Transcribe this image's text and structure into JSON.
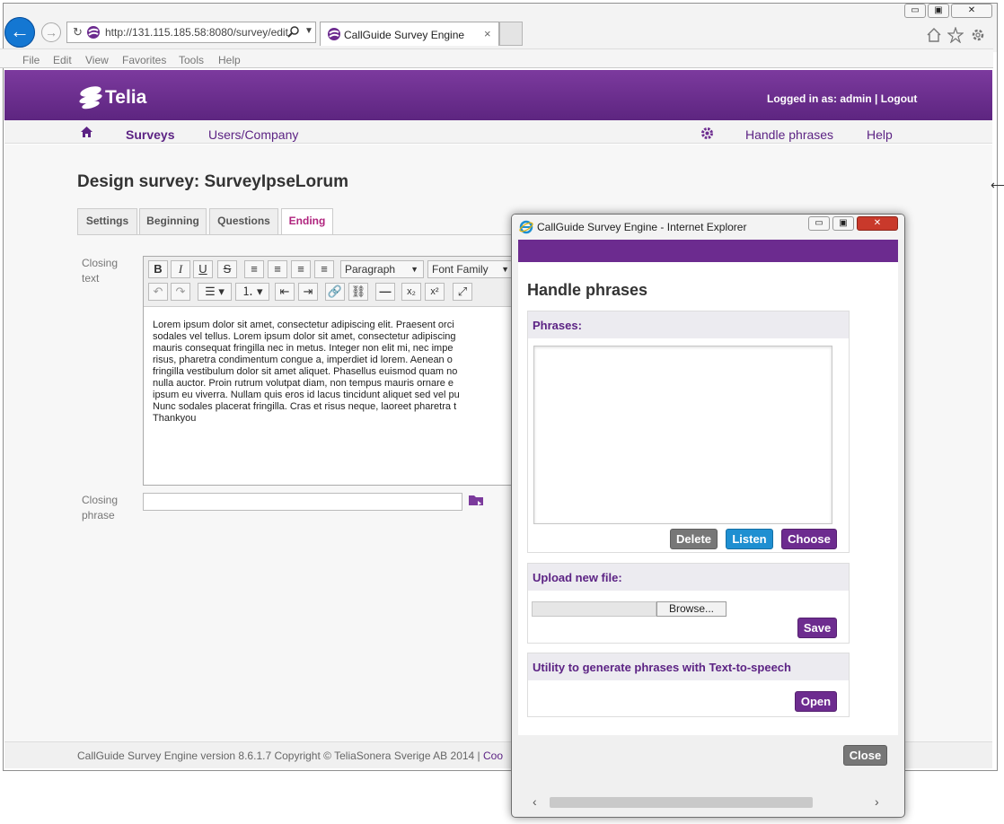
{
  "browser": {
    "address": "http://131.115.185.58:8080/survey/edit",
    "tab_title": "CallGuide Survey Engine",
    "tab_close": "×",
    "back_arrow": "←",
    "forward_arrow": "→",
    "window_buttons": [
      "▭",
      "▣",
      "✕"
    ],
    "menu": [
      "File",
      "Edit",
      "View",
      "Favorites",
      "Tools",
      "Help"
    ],
    "icons": [
      "home-icon",
      "star-icon",
      "gear-icon"
    ]
  },
  "header": {
    "logo": "Telia",
    "logged_in_prefix": "Logged in as: ",
    "user": "admin",
    "separator": " | ",
    "logout": "Logout"
  },
  "nav": {
    "surveys": "Surveys",
    "users": "Users/Company",
    "handle_phrases": "Handle phrases",
    "help": "Help"
  },
  "page": {
    "title": "Design survey: SurveyIpseLorum",
    "tabs": [
      "Settings",
      "Beginning",
      "Questions",
      "Ending"
    ],
    "active_tab": "Ending",
    "closing_text_label_1": "Closing",
    "closing_text_label_2": "text",
    "closing_phrase_label_1": "Closing",
    "closing_phrase_label_2": "phrase",
    "closing_phrase_value": ""
  },
  "editor": {
    "paragraph": "Paragraph",
    "font_family": "Font Family",
    "lines": [
      "Lorem ipsum dolor sit amet, consectetur adipiscing elit. Praesent orci",
      "sodales vel tellus. Lorem ipsum dolor sit amet, consectetur adipiscing",
      "mauris consequat fringilla nec in metus. Integer non elit mi, nec impe",
      "risus, pharetra condimentum congue a, imperdiet id lorem. Aenean o",
      "fringilla vestibulum dolor sit amet aliquet. Phasellus euismod quam no",
      "nulla auctor. Proin rutrum volutpat diam, non tempus mauris ornare e",
      "ipsum eu viverra. Nullam quis eros id lacus tincidunt aliquet sed vel pu",
      "Nunc sodales placerat fringilla. Cras et risus neque, laoreet pharetra t",
      "Thankyou"
    ]
  },
  "footer": {
    "text": "CallGuide Survey Engine version 8.6.1.7 Copyright © TeliaSonera Sverige AB 2014 | ",
    "link": "Coo"
  },
  "popup": {
    "window_title": "CallGuide Survey Engine - Internet Explorer",
    "heading": "Handle phrases",
    "phrases_title": "Phrases:",
    "delete": "Delete",
    "listen": "Listen",
    "choose": "Choose",
    "upload_title": "Upload new file:",
    "browse": "Browse...",
    "save": "Save",
    "tts_title": "Utility to generate phrases with Text-to-speech",
    "open": "Open",
    "close": "Close",
    "colors": {
      "purple": "#6d2c8f",
      "listen": "#1e8fd1",
      "gray": "#777777"
    }
  }
}
